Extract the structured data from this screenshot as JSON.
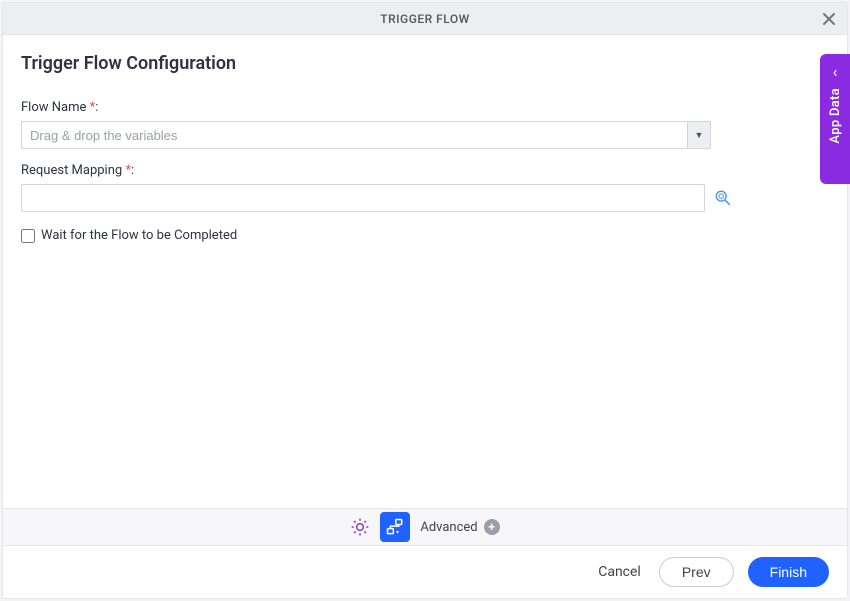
{
  "header": {
    "title": "TRIGGER FLOW"
  },
  "page": {
    "title": "Trigger Flow Configuration"
  },
  "form": {
    "flow_name": {
      "label": "Flow Name",
      "placeholder": "Drag & drop the variables",
      "value": ""
    },
    "request_mapping": {
      "label": "Request Mapping",
      "value": ""
    },
    "wait_checkbox": {
      "label": "Wait for the Flow to be Completed",
      "checked": false
    }
  },
  "toolbar": {
    "advanced_label": "Advanced"
  },
  "footer": {
    "cancel_label": "Cancel",
    "prev_label": "Prev",
    "finish_label": "Finish"
  },
  "side_tab": {
    "label": "App Data"
  },
  "required_mark": "*",
  "colon": ":"
}
